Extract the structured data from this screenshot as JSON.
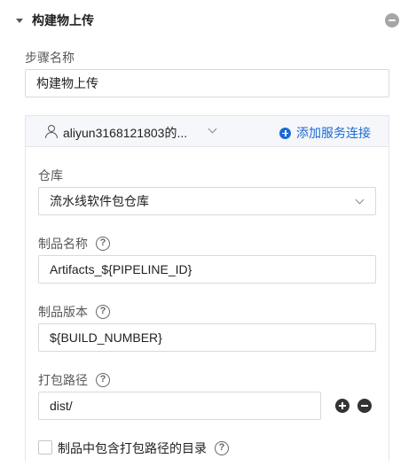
{
  "section": {
    "title": "构建物上传"
  },
  "step_name": {
    "label": "步骤名称",
    "value": "构建物上传"
  },
  "connection": {
    "account": "aliyun3168121803的...",
    "add_label": "添加服务连接"
  },
  "repository": {
    "label": "仓库",
    "value": "流水线软件包仓库"
  },
  "artifact_name": {
    "label": "制品名称",
    "value": "Artifacts_${PIPELINE_ID}"
  },
  "artifact_version": {
    "label": "制品版本",
    "value": "${BUILD_NUMBER}"
  },
  "package_path": {
    "label": "打包路径",
    "value": "dist/"
  },
  "include_dir": {
    "label": "制品中包含打包路径的目录",
    "checked": false
  },
  "help_glyph": "?"
}
